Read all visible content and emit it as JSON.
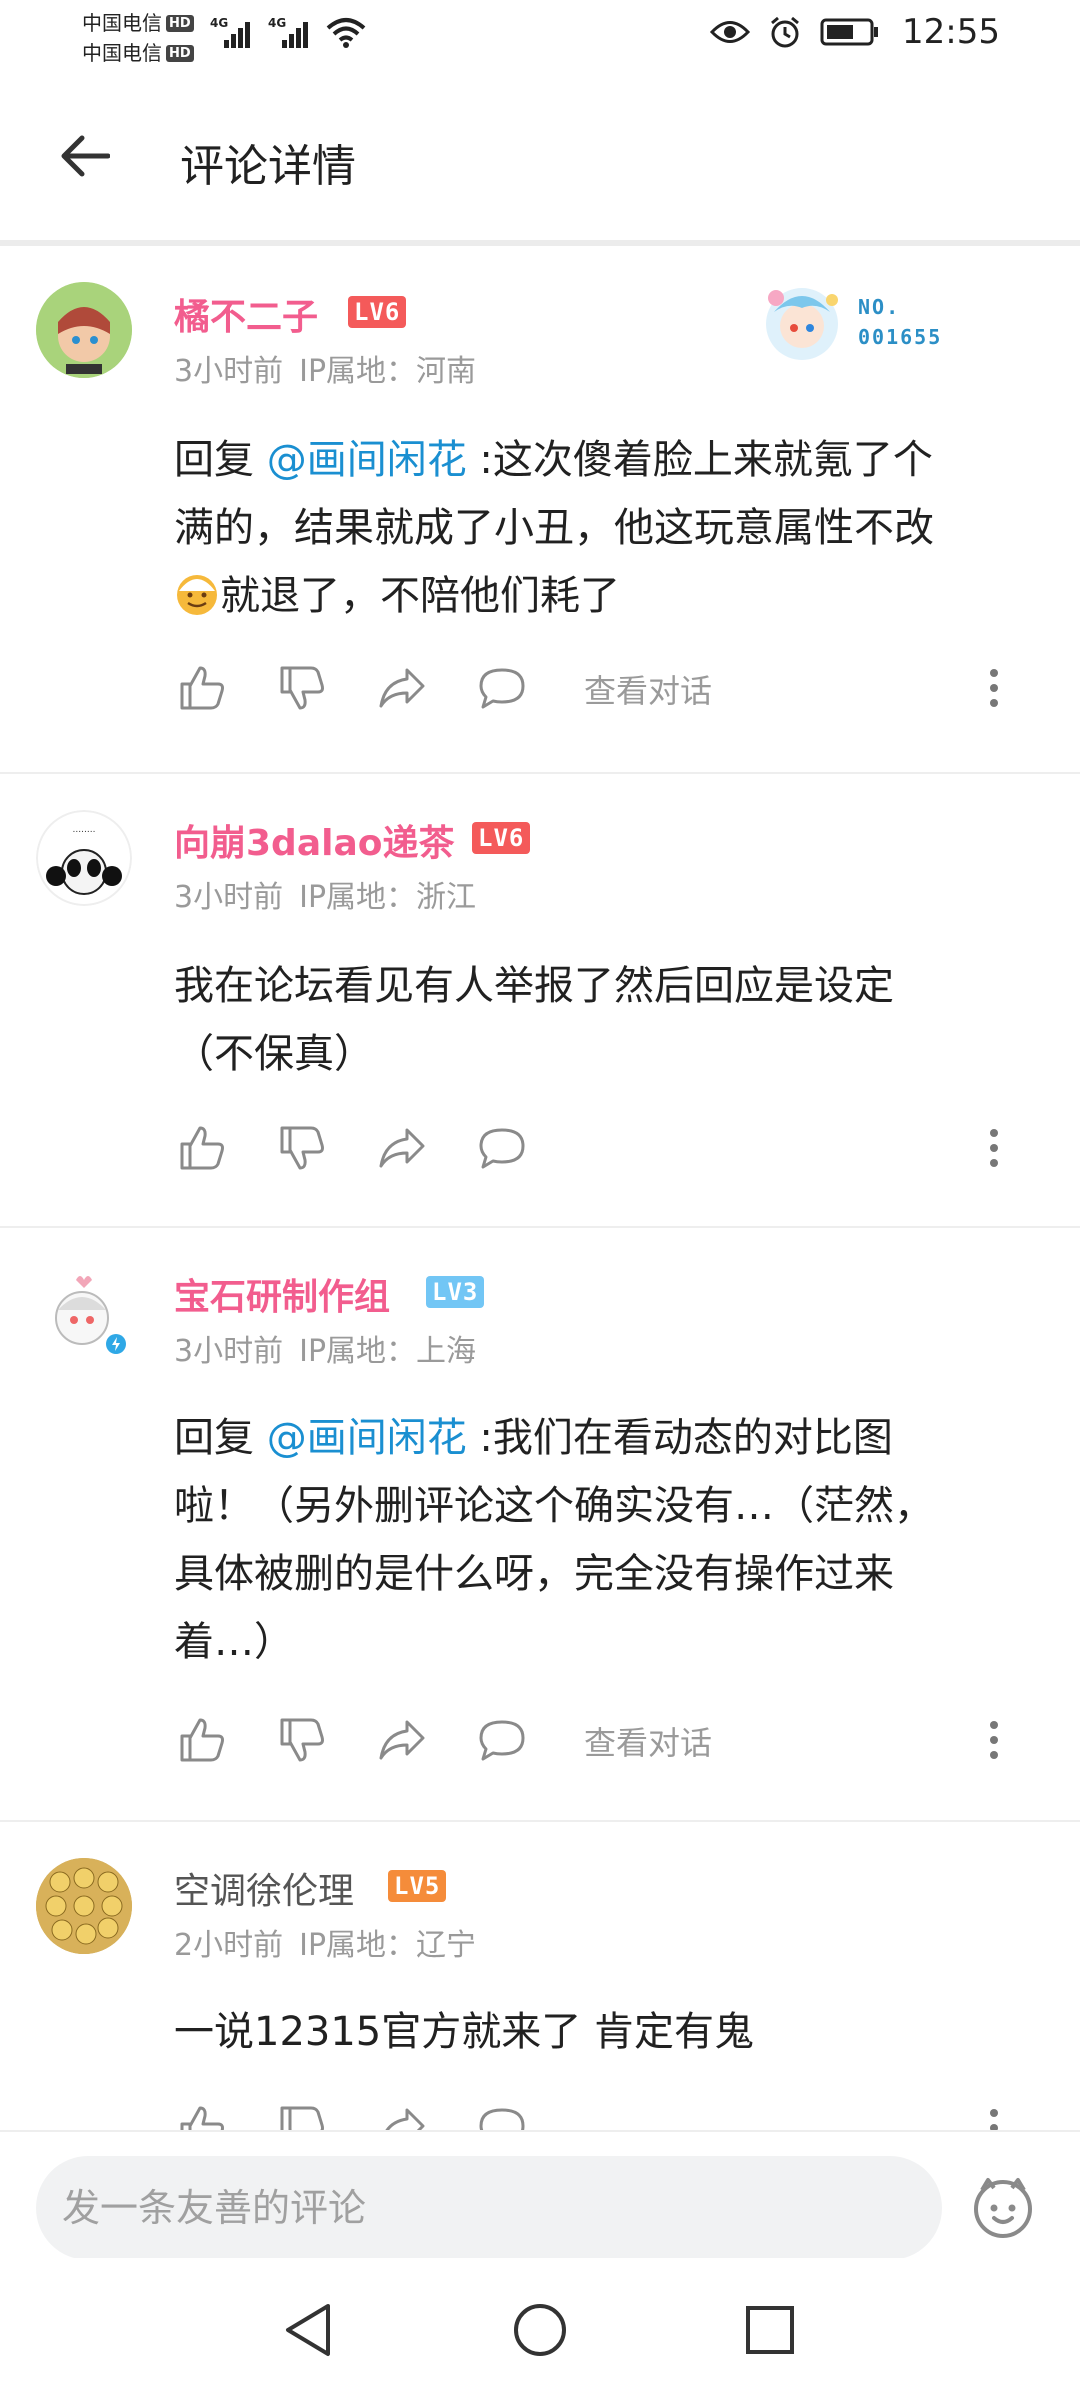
{
  "status_bar": {
    "carrier_1": "中国电信",
    "carrier_2": "中国电信",
    "hd": "HD",
    "network": "4G",
    "time": "12:55"
  },
  "header": {
    "title": "评论详情"
  },
  "comments": [
    {
      "username": "橘不二子",
      "level": "LV6",
      "time": "3小时前",
      "ip": "IP属地：河南",
      "badge_no": "NO.",
      "badge_num": "001655",
      "reply_prefix": "回复 ",
      "mention": "@画间闲花",
      "text_1": " :这次傻着脸上来就氪了个",
      "text_2": "满的，结果就成了小丑，他这玩意属性不改",
      "text_3": "就退了，不陪他们耗了",
      "view_dialog": "查看对话"
    },
    {
      "username": "向崩3dalao递茶",
      "level": "LV6",
      "time": "3小时前",
      "ip": "IP属地：浙江",
      "text_1": "我在论坛看见有人举报了然后回应是设定",
      "text_2": "（不保真）"
    },
    {
      "username": "宝石研制作组",
      "level": "LV3",
      "time": "3小时前",
      "ip": "IP属地：上海",
      "reply_prefix": "回复 ",
      "mention": "@画间闲花",
      "text_1": " :我们在看动态的对比图",
      "text_2": "啦！（另外删评论这个确实没有…（茫然，",
      "text_3": "具体被删的是什么呀，完全没有操作过来",
      "text_4": "着…）",
      "view_dialog": "查看对话"
    },
    {
      "username": "空调徐伦理",
      "level": "LV5",
      "time": "2小时前",
      "ip": "IP属地：辽宁",
      "text_1": "一说12315官方就来了   肯定有鬼"
    }
  ],
  "bottom": {
    "placeholder": "发一条友善的评论"
  },
  "colors": {
    "username_pink": "#f25d8e",
    "mention_blue": "#1a8fd1",
    "meta_gray": "#9a9a9a"
  }
}
